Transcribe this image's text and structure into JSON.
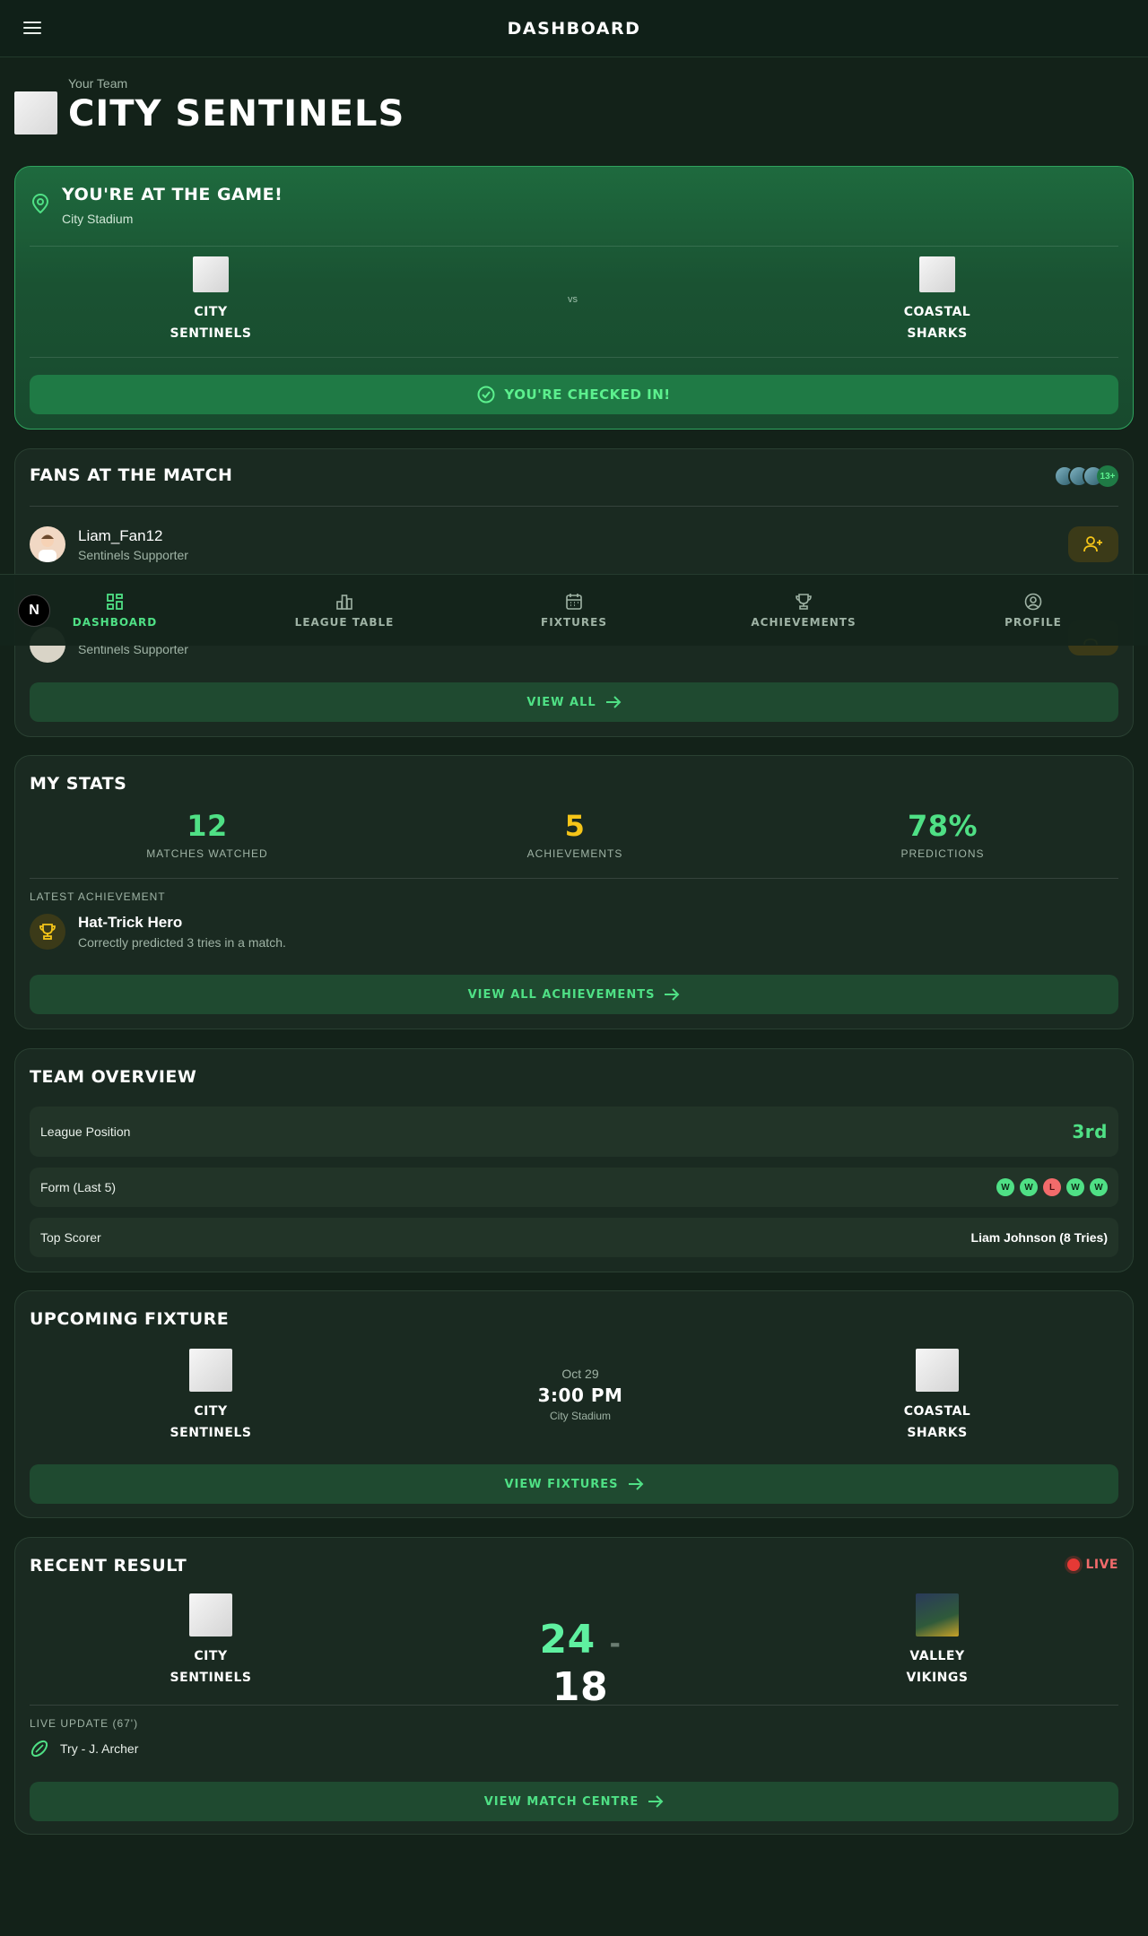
{
  "topbar": {
    "title": "DASHBOARD"
  },
  "team": {
    "label": "Your Team",
    "name": "CITY SENTINELS"
  },
  "at_game": {
    "title": "YOU'RE AT THE GAME!",
    "venue": "City Stadium",
    "home_line1": "CITY",
    "home_line2": "SENTINELS",
    "vs": "vs",
    "away_line1": "COASTAL",
    "away_line2": "SHARKS",
    "checkin_label": "YOU'RE CHECKED IN!"
  },
  "fans": {
    "title": "FANS AT THE MATCH",
    "more_count": "13+",
    "list": [
      {
        "name": "Liam_Fan12",
        "role": "Sentinels Supporter"
      },
      {
        "name": "",
        "role": "Sentinels Supporter"
      }
    ],
    "view_all": "VIEW ALL"
  },
  "bottom_nav": {
    "badge": "N",
    "items": [
      {
        "label": "DASHBOARD"
      },
      {
        "label": "LEAGUE TABLE"
      },
      {
        "label": "FIXTURES"
      },
      {
        "label": "ACHIEVEMENTS"
      },
      {
        "label": "PROFILE"
      }
    ]
  },
  "stats": {
    "title": "MY STATS",
    "items": [
      {
        "value": "12",
        "label": "MATCHES WATCHED"
      },
      {
        "value": "5",
        "label": "ACHIEVEMENTS"
      },
      {
        "value": "78%",
        "label": "PREDICTIONS"
      }
    ],
    "latest_label": "LATEST ACHIEVEMENT",
    "latest_name": "Hat-Trick Hero",
    "latest_desc": "Correctly predicted 3 tries in a match.",
    "view_all": "VIEW ALL ACHIEVEMENTS"
  },
  "overview": {
    "title": "TEAM OVERVIEW",
    "position_label": "League Position",
    "position_value": "3rd",
    "form_label": "Form (Last 5)",
    "form": [
      "W",
      "W",
      "L",
      "W",
      "W"
    ],
    "scorer_label": "Top Scorer",
    "scorer_value": "Liam Johnson (8 Tries)"
  },
  "fixture": {
    "title": "UPCOMING FIXTURE",
    "home_line1": "CITY",
    "home_line2": "SENTINELS",
    "away_line1": "COASTAL",
    "away_line2": "SHARKS",
    "date": "Oct 29",
    "time": "3:00 PM",
    "venue": "City Stadium",
    "button": "VIEW FIXTURES"
  },
  "result": {
    "title": "RECENT RESULT",
    "live": "LIVE",
    "home_line1": "CITY",
    "home_line2": "SENTINELS",
    "away_line1": "VALLEY",
    "away_line2": "VIKINGS",
    "home_score": "24",
    "sep": "-",
    "away_score": "18",
    "update_label": "LIVE UPDATE (67')",
    "update_text": "Try - J. Archer",
    "button": "VIEW MATCH CENTRE"
  },
  "colors": {
    "accent_green": "#4fe085",
    "accent_yellow": "#f5c518",
    "win": "#4fe085",
    "loss": "#f26b6b",
    "live_red": "#e53935"
  }
}
